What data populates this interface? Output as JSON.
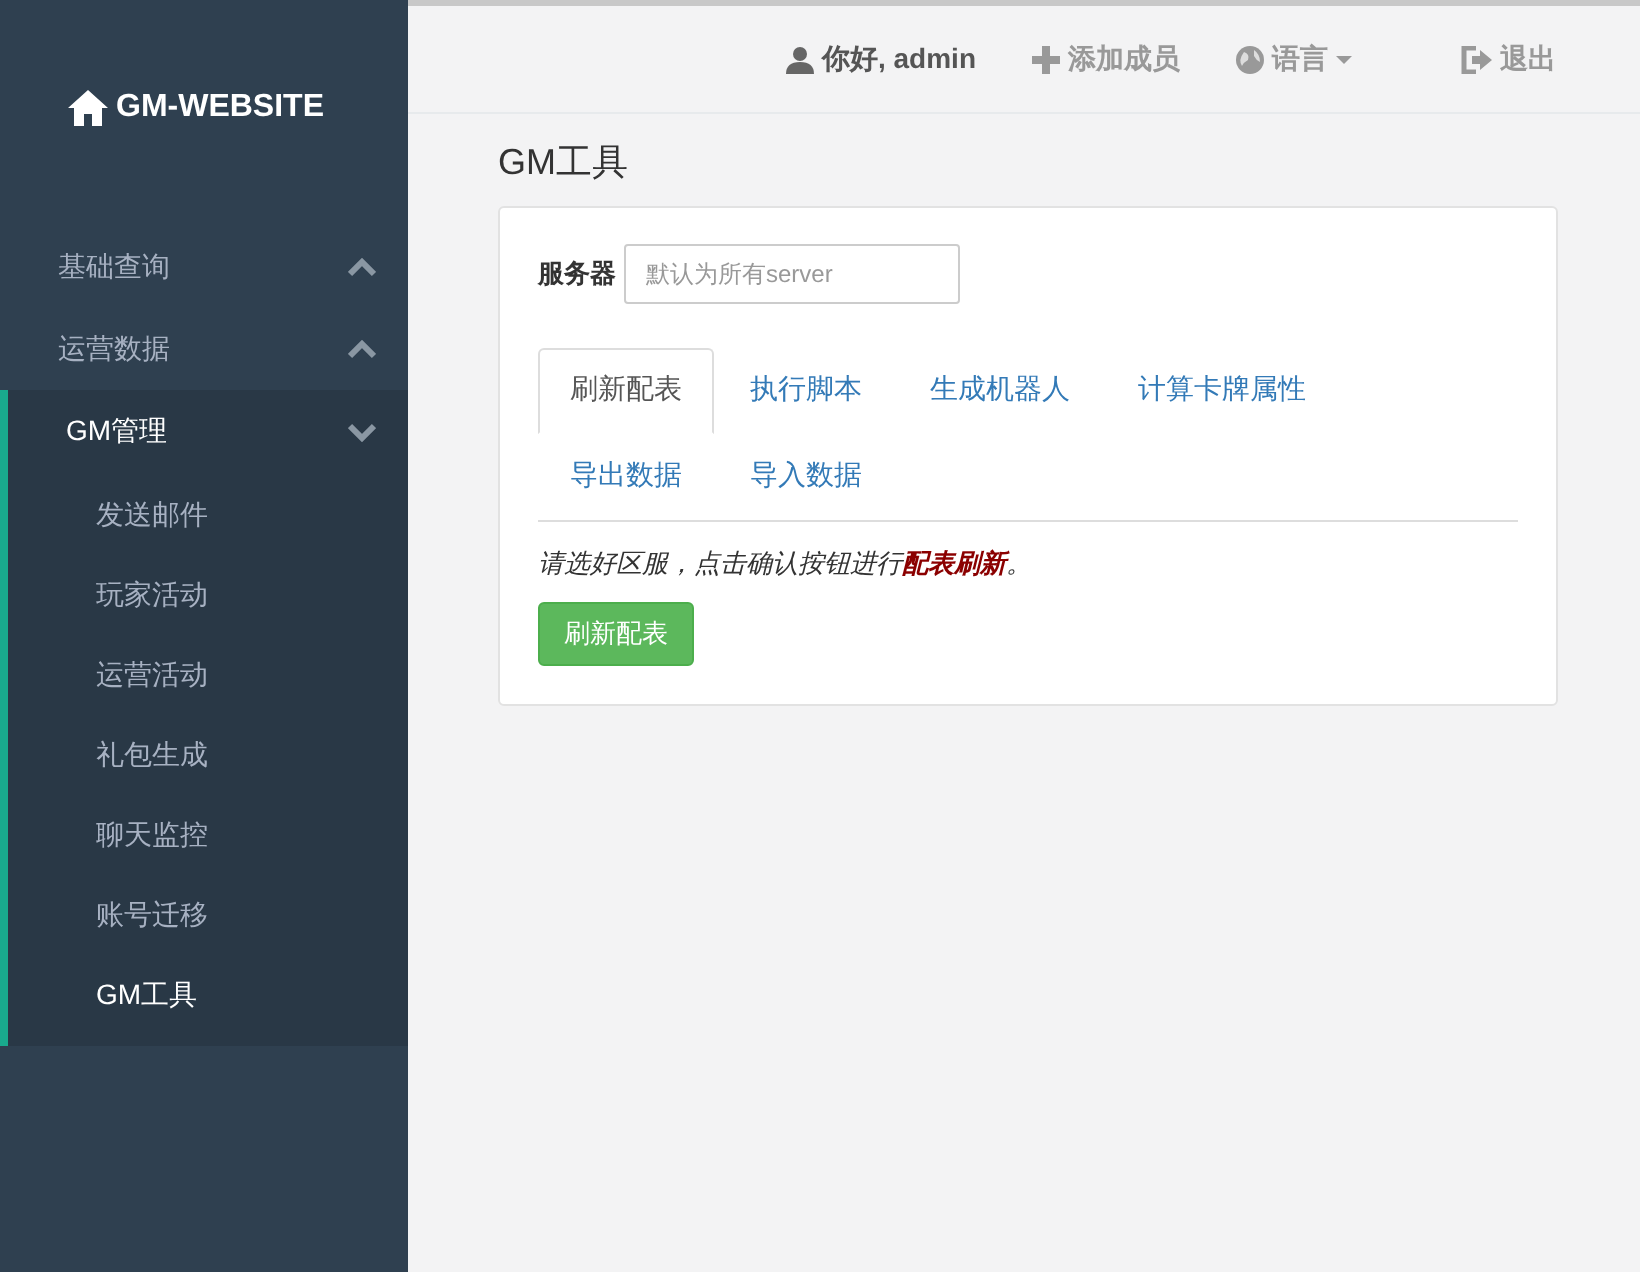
{
  "sidebar": {
    "logo": "GM-WEBSITE",
    "items": [
      {
        "label": "基础查询",
        "expanded": false
      },
      {
        "label": "运营数据",
        "expanded": false
      },
      {
        "label": "GM管理",
        "expanded": true,
        "children": [
          {
            "label": "发送邮件",
            "selected": false
          },
          {
            "label": "玩家活动",
            "selected": false
          },
          {
            "label": "运营活动",
            "selected": false
          },
          {
            "label": "礼包生成",
            "selected": false
          },
          {
            "label": "聊天监控",
            "selected": false
          },
          {
            "label": "账号迁移",
            "selected": false
          },
          {
            "label": "GM工具",
            "selected": true
          }
        ]
      }
    ]
  },
  "header": {
    "greeting": "你好, admin",
    "add_member": "添加成员",
    "language": "语言",
    "logout": "退出"
  },
  "page_title": "GM工具",
  "form": {
    "label": "服务器",
    "placeholder": "默认为所有server"
  },
  "tabs": [
    {
      "label": "刷新配表",
      "selected": true
    },
    {
      "label": "执行脚本",
      "selected": false
    },
    {
      "label": "生成机器人",
      "selected": false
    },
    {
      "label": "计算卡牌属性",
      "selected": false
    },
    {
      "label": "导出数据",
      "selected": false
    },
    {
      "label": "导入数据",
      "selected": false
    }
  ],
  "message": "请选好区服，点击确认按钮进行**配表刷新**。",
  "action_button": "刷新配表"
}
